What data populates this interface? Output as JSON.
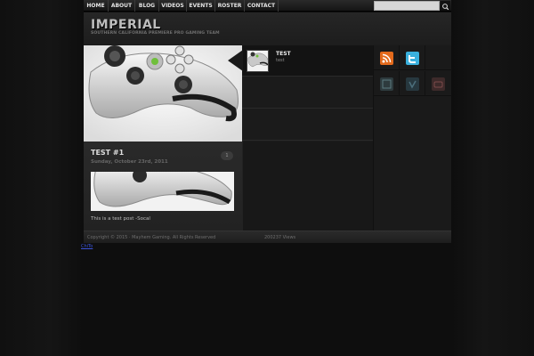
{
  "nav": {
    "items": [
      "HOME",
      "ABOUT",
      "BLOG",
      "VIDEOS",
      "EVENTS",
      "ROSTER",
      "CONTACT"
    ],
    "search_placeholder": ""
  },
  "header": {
    "logo": "IMPERIAL",
    "tagline": "SOUTHERN CALIFORNIA PREMIERE PRO GAMING TEAM"
  },
  "featured": {
    "items": [
      {
        "title": "TEST",
        "subtitle": "test"
      }
    ]
  },
  "post": {
    "title": "TEST #1",
    "date": "Sunday, October 23rd, 2011",
    "comments": "1",
    "excerpt": "This is a test post -Socal"
  },
  "sidebar": {
    "icons": [
      "rss-icon",
      "twitter-icon",
      "facebook-icon",
      "vimeo-icon",
      "youtube-icon"
    ]
  },
  "footer": {
    "copyright": "Copyright © 2015 · Mayhem Gaming. All Rights Reserved",
    "views": "200237 Views"
  },
  "link": {
    "text": "ChiTo"
  },
  "colors": {
    "rss": "#e36a1c",
    "twitter": "#3ab0dd",
    "link": "#3a52d8"
  }
}
